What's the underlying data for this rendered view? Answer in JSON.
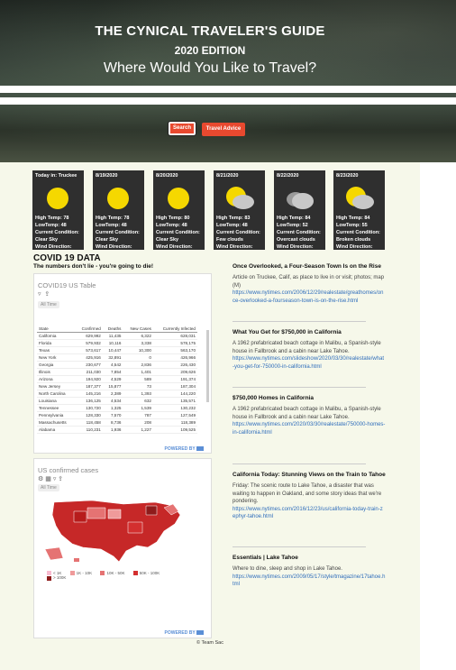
{
  "header": {
    "title": "THE CYNICAL TRAVELER'S GUIDE",
    "edition": "2020 EDITION",
    "prompt": "Where Would You Like to Travel?",
    "search_label": "Search",
    "advice_label": "Travel Advice"
  },
  "weather": [
    {
      "date": "Today in: Truckee",
      "icon": "sun-icon",
      "high": "High Temp: 78",
      "low": "LowTemp: 48",
      "cond_label": "Current Condition:",
      "cond": "Clear Sky",
      "wind": "Wind Direction:"
    },
    {
      "date": "8/19/2020",
      "icon": "sun-icon",
      "high": "High Temp: 78",
      "low": "LowTemp: 48",
      "cond_label": "Current Condition:",
      "cond": "Clear Sky",
      "wind": "Wind Direction:"
    },
    {
      "date": "8/20/2020",
      "icon": "sun-icon",
      "high": "High Temp: 80",
      "low": "LowTemp: 48",
      "cond_label": "Current Condition:",
      "cond": "Clear Sky",
      "wind": "Wind Direction:"
    },
    {
      "date": "8/21/2020",
      "icon": "partly-cloudy-icon",
      "high": "High Temp: 83",
      "low": "LowTemp: 48",
      "cond_label": "Current Condition:",
      "cond": "Few clouds",
      "wind": "Wind Direction:"
    },
    {
      "date": "8/22/2020",
      "icon": "cloud-icon",
      "high": "High Temp: 84",
      "low": "LowTemp: 52",
      "cond_label": "Current Condition:",
      "cond": "Overcast clouds",
      "wind": "Wind Direction:"
    },
    {
      "date": "8/23/2020",
      "icon": "partly-cloudy-icon",
      "high": "High Temp: 84",
      "low": "LowTemp: 55",
      "cond_label": "Current Condition:",
      "cond": "Broken clouds",
      "wind": "Wind Direction:"
    }
  ],
  "covid": {
    "title": "COVID 19 DATA",
    "subtitle": "The numbers don't lie - you're going to die!",
    "table_panel": {
      "title": "COVID19 US Table",
      "time_filter": "All Time",
      "powered": "POWERED BY",
      "columns": [
        "State",
        "Confirmed",
        "Deaths",
        "New Cases",
        "Currently Infected"
      ],
      "rows": [
        [
          "California",
          "629,992",
          "11,435",
          "6,322",
          "628,031"
        ],
        [
          "Florida",
          "579,932",
          "10,116",
          "3,338",
          "578,175"
        ],
        [
          "Texas",
          "573,617",
          "10,447",
          "10,300",
          "563,170"
        ],
        [
          "New York",
          "425,916",
          "32,891",
          "0",
          "426,966"
        ],
        [
          "Georgia",
          "230,677",
          "4,542",
          "2,836",
          "226,430"
        ],
        [
          "Illinois",
          "211,030",
          "7,854",
          "1,401",
          "209,626"
        ],
        [
          "Arizona",
          "194,920",
          "4,529",
          "589",
          "191,374"
        ],
        [
          "New Jersey",
          "187,377",
          "15,877",
          "73",
          "187,304"
        ],
        [
          "North Carolina",
          "145,216",
          "2,389",
          "1,393",
          "144,220"
        ],
        [
          "Louisiana",
          "136,125",
          "4,534",
          "632",
          "135,571"
        ],
        [
          "Tennessee",
          "130,720",
          "1,325",
          "1,539",
          "130,232"
        ],
        [
          "Pennsylvania",
          "128,330",
          "7,570",
          "787",
          "127,549"
        ],
        [
          "Massachusetts",
          "118,458",
          "8,736",
          "208",
          "118,389"
        ],
        [
          "Alabama",
          "110,231",
          "1,936",
          "1,227",
          "109,525"
        ]
      ]
    },
    "map_panel": {
      "title": "US confirmed cases",
      "time_filter": "All Time",
      "powered": "POWERED BY",
      "legend": [
        "< 1K",
        "1K - 10K",
        "10K - 50K",
        "50K - 100K",
        "> 100K"
      ]
    }
  },
  "articles": [
    {
      "title": "Once Overlooked, a Four-Season Town Is on the Rise",
      "desc": "Article on Truckee, Calif, as place to live in or visit; photos; map (M)",
      "link": "https://www.nytimes.com/2006/12/29/realestate/greathomes/once-overlooked-a-fourseason-town-is-on-the-rise.html"
    },
    {
      "title": "What You Get for $750,000 in California",
      "desc": "A 1962 prefabricated beach cottage in Malibu, a Spanish-style house in Fallbrook and a cabin near Lake Tahoe.",
      "link": "https://www.nytimes.com/slideshow/2020/03/30/realestate/what-you-get-for-750000-in-california.html"
    },
    {
      "title": "$750,000 Homes in California",
      "desc": "A 1962 prefabricated beach cottage in Malibu, a Spanish-style house in Fallbrook and a cabin near Lake Tahoe.",
      "link": "https://www.nytimes.com/2020/03/30/realestate/750000-homes-in-california.html"
    },
    {
      "title": "California Today: Stunning Views on the Train to Tahoe",
      "desc": "Friday: The scenic route to Lake Tahoe, a disaster that was waiting to happen in Oakland, and some story ideas that we're pondering.",
      "link": "https://www.nytimes.com/2016/12/23/us/california-today-train-zephyr-tahoe.html"
    },
    {
      "title": "Essentials | Lake Tahoe",
      "desc": "Where to dine, sleep and shop in Lake Tahoe.",
      "link": "https://www.nytimes.com/2009/05/17/style/tmagazine/17tahoe.html"
    }
  ],
  "footer": "© Team Sac",
  "colors": {
    "accent": "#e8492f",
    "panel": "#2f2f2f",
    "link": "#2f6dbb",
    "sun": "#f5d800"
  }
}
